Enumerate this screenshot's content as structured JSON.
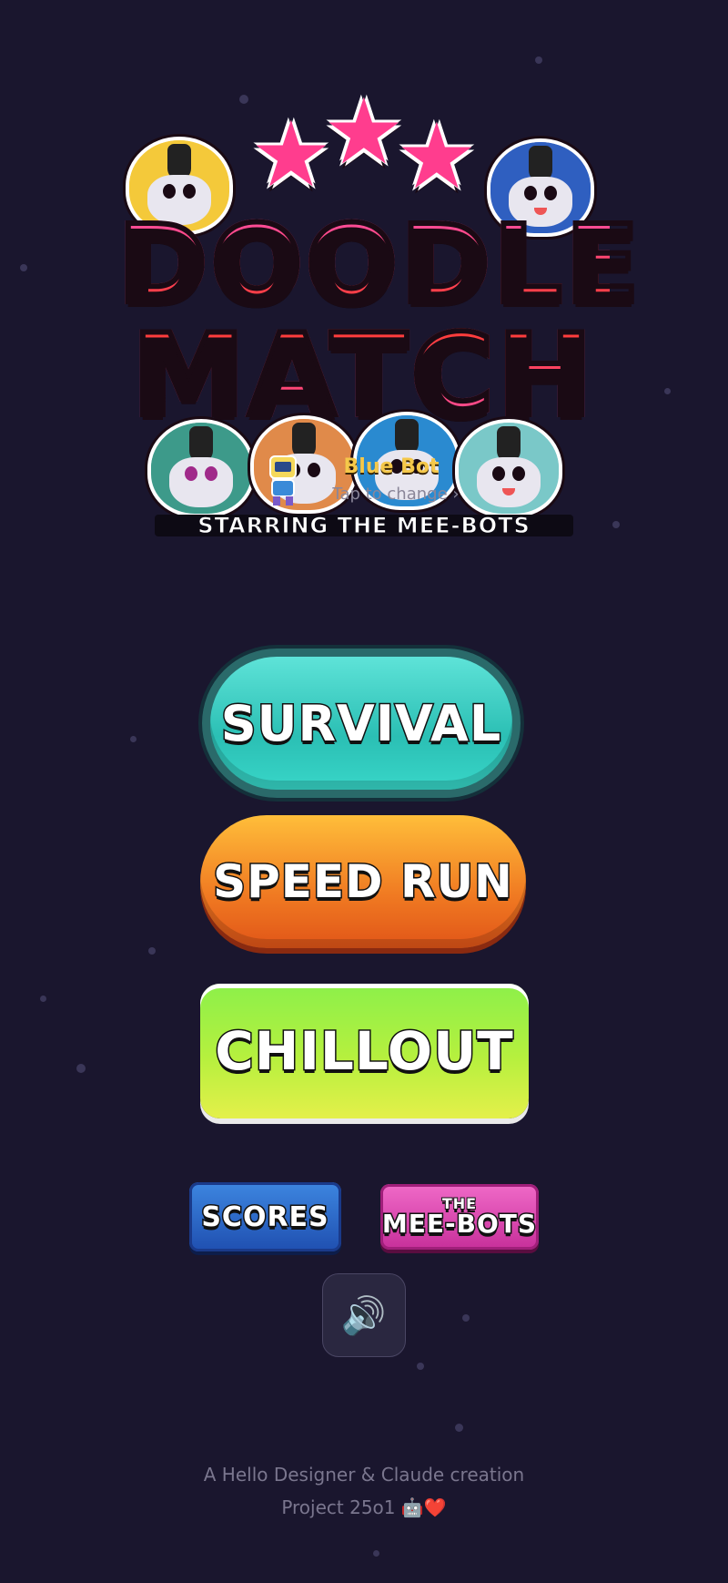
{
  "logo": {
    "line1": "DOODLE",
    "line2": "MATCH",
    "tagline": "STARRING THE MEE-BOTS"
  },
  "character": {
    "name": "Blue Bot",
    "hint": "Tap to change ›"
  },
  "modes": {
    "survival": "SURVIVAL",
    "speed_run": "SPEED RUN",
    "chillout": "CHILLOUT"
  },
  "secondary": {
    "scores": "SCORES",
    "meebots_small": "THE",
    "meebots_big": "MEE-BOTS"
  },
  "sound": {
    "icon": "🔊"
  },
  "footer": {
    "credit": "A Hello Designer & Claude creation",
    "project": "Project 25o1 🤖❤️"
  },
  "colors": {
    "background": "#1a162e",
    "survival": "#38d6c8",
    "speed_run": "#f07a22",
    "chillout": "#b6f03e",
    "scores": "#2a63c8",
    "meebots": "#d83fa8"
  }
}
